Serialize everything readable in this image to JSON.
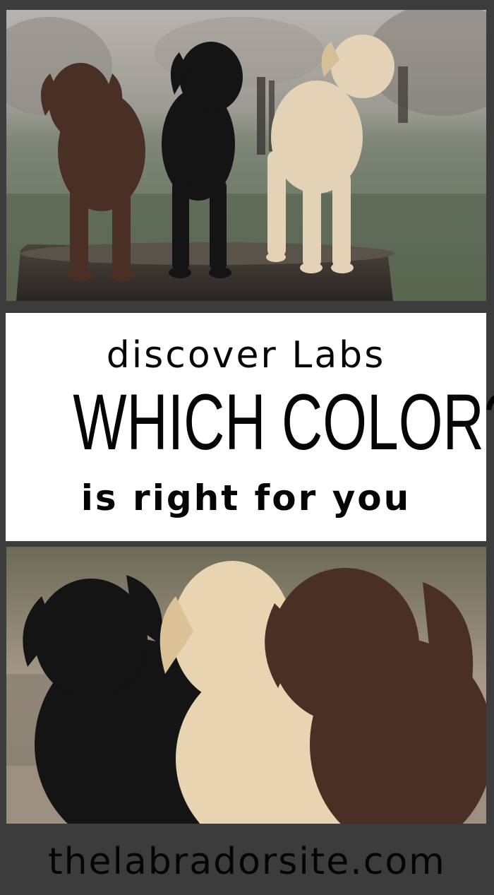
{
  "headline": {
    "line1": "discover Labs",
    "line2": "WHICH COLOR?",
    "line3": "is right for you"
  },
  "footer": {
    "site": "thelabradorsite.com"
  },
  "colors": {
    "frame": "#3c3c3c",
    "panel": "#ffffff",
    "text": "#050505",
    "chocolate_coat": "#4a2f25",
    "black_coat": "#141414",
    "yellow_coat": "#e3d2b6"
  }
}
